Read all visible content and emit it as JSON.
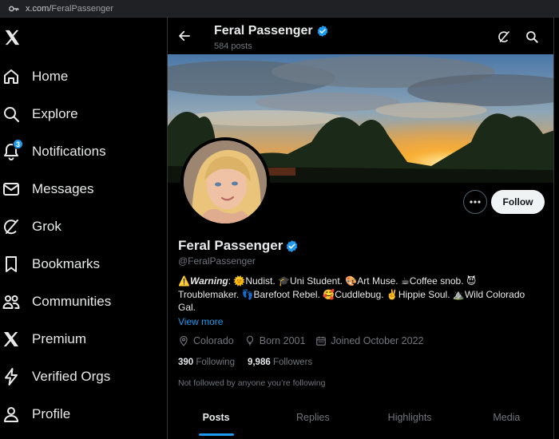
{
  "browser": {
    "url_domain": "x.com/",
    "url_path": "FeralPassenger"
  },
  "nav": {
    "items": [
      {
        "label": "Home",
        "icon": "home-icon"
      },
      {
        "label": "Explore",
        "icon": "search-icon"
      },
      {
        "label": "Notifications",
        "icon": "bell-icon",
        "badge": "3"
      },
      {
        "label": "Messages",
        "icon": "envelope-icon"
      },
      {
        "label": "Grok",
        "icon": "grok-icon"
      },
      {
        "label": "Bookmarks",
        "icon": "bookmark-icon"
      },
      {
        "label": "Communities",
        "icon": "people-icon"
      },
      {
        "label": "Premium",
        "icon": "x-logo-icon"
      },
      {
        "label": "Verified Orgs",
        "icon": "lightning-icon"
      },
      {
        "label": "Profile",
        "icon": "person-icon"
      }
    ]
  },
  "header": {
    "name": "Feral Passenger",
    "posts": "584 posts"
  },
  "profile": {
    "name": "Feral Passenger",
    "handle": "@FeralPassenger",
    "follow_label": "Follow",
    "bio_warning": "Warning",
    "bio_line1": ": 🌞Nudist. 🎓Uni Student. 🎨Art Muse. ☕Coffee snob. 😈",
    "bio_line2": "Troublemaker. 👣Barefoot Rebel. 🥰Cuddlebug. ✌️Hippie Soul. ⛰️Wild Colorado",
    "bio_line3": "Gal.",
    "view_more": "View more",
    "location": "Colorado",
    "born": "Born 2001",
    "joined": "Joined October 2022",
    "following_count": "390",
    "following_label": "Following",
    "followers_count": "9,986",
    "followers_label": "Followers",
    "not_followed": "Not followed by anyone you’re following"
  },
  "tabs": [
    "Posts",
    "Replies",
    "Highlights",
    "Media"
  ],
  "colors": {
    "accent": "#1d9bf0",
    "background": "#000000",
    "muted": "#71767b"
  }
}
